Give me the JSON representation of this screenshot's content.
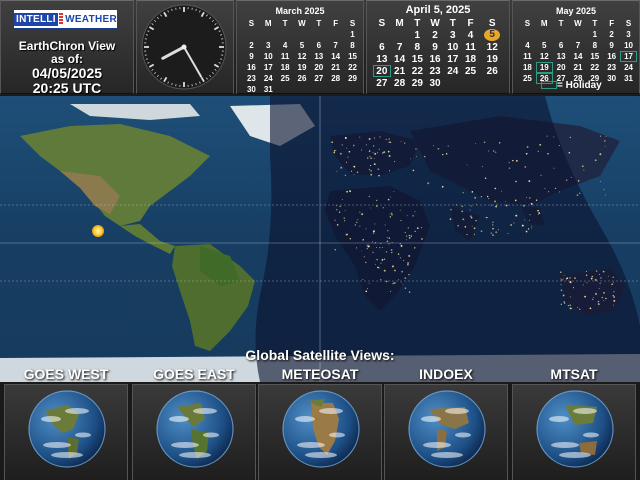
{
  "header": {
    "logo_part1": "INTELLI",
    "logo_part2": "WEATHER",
    "view_title": "EarthChron View",
    "as_of": "as of:",
    "date": "04/05/2025",
    "time": "20:25 UTC"
  },
  "clock": {
    "hour_hand_angle_deg": 242,
    "minute_hand_angle_deg": 150
  },
  "day_names": [
    "S",
    "M",
    "T",
    "W",
    "T",
    "F",
    "S"
  ],
  "calendars": {
    "march": {
      "title": "March 2025",
      "weeks": [
        [
          "",
          "",
          "",
          "",
          "",
          "",
          "1"
        ],
        [
          "2",
          "3",
          "4",
          "5",
          "6",
          "7",
          "8"
        ],
        [
          "9",
          "10",
          "11",
          "12",
          "13",
          "14",
          "15"
        ],
        [
          "16",
          "17",
          "18",
          "19",
          "20",
          "21",
          "22"
        ],
        [
          "23",
          "24",
          "25",
          "26",
          "27",
          "28",
          "29"
        ],
        [
          "30",
          "31",
          "",
          "",
          "",
          "",
          ""
        ]
      ]
    },
    "april": {
      "title": "April 5, 2025",
      "today": "5",
      "holidays": [
        "20"
      ],
      "weeks": [
        [
          "",
          "",
          "1",
          "2",
          "3",
          "4",
          "5"
        ],
        [
          "6",
          "7",
          "8",
          "9",
          "10",
          "11",
          "12"
        ],
        [
          "13",
          "14",
          "15",
          "16",
          "17",
          "18",
          "19"
        ],
        [
          "20",
          "21",
          "22",
          "23",
          "24",
          "25",
          "26"
        ],
        [
          "27",
          "28",
          "29",
          "30",
          "",
          "",
          ""
        ]
      ]
    },
    "may": {
      "title": "May 2025",
      "holidays": [
        "17",
        "19",
        "26"
      ],
      "weeks": [
        [
          "",
          "",
          "",
          "",
          "1",
          "2",
          "3"
        ],
        [
          "4",
          "5",
          "6",
          "7",
          "8",
          "9",
          "10"
        ],
        [
          "11",
          "12",
          "13",
          "14",
          "15",
          "16",
          "17"
        ],
        [
          "18",
          "19",
          "20",
          "21",
          "22",
          "23",
          "24"
        ],
        [
          "25",
          "26",
          "27",
          "28",
          "29",
          "30",
          "31"
        ]
      ]
    }
  },
  "legend": {
    "holiday_label": "= Holiday",
    "holiday_color": "#2f9a86"
  },
  "map": {
    "heading": "Global Satellite Views:",
    "ocean_color": "#173e63",
    "night_color": "#0c1430",
    "sun_color": "#ffd23c"
  },
  "satellites": [
    {
      "label": "GOES WEST"
    },
    {
      "label": "GOES EAST"
    },
    {
      "label": "METEOSAT"
    },
    {
      "label": "INDOEX"
    },
    {
      "label": "MTSAT"
    }
  ]
}
